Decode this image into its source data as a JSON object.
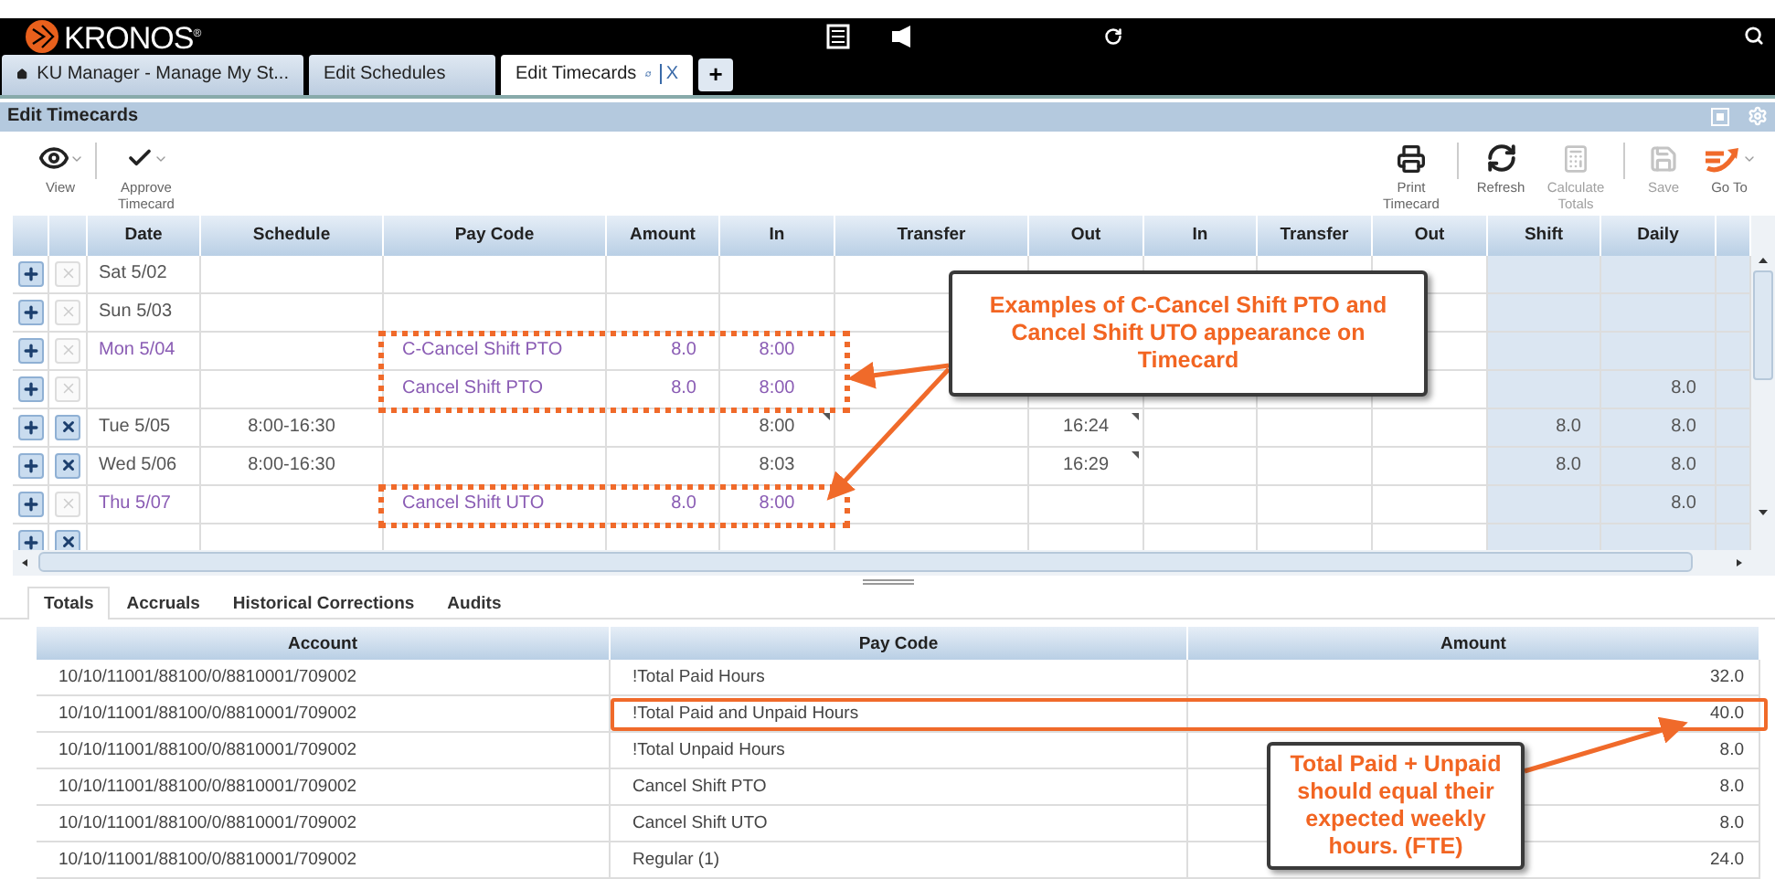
{
  "header": {
    "brand": "KRONOS$^{®}$"
  },
  "tabs": [
    {
      "label": "KU Manager - Manage My St...",
      "selected": false,
      "home": true
    },
    {
      "label": "Edit Schedules",
      "selected": false,
      "home": false
    },
    {
      "label": "Edit Timecards",
      "selected": true,
      "home": false,
      "close": "X"
    }
  ],
  "add_tab": "+",
  "page_title": "Edit Timecards",
  "toolbar_left": [
    {
      "kind": "view",
      "label": "View",
      "disabled": false,
      "dropdown": true
    },
    {
      "kind": "approve",
      "label": "Approve Timecard",
      "disabled": false,
      "dropdown": true
    }
  ],
  "toolbar_right": [
    {
      "kind": "print",
      "label": "Print Timecard",
      "disabled": false,
      "dropdown": false
    },
    {
      "kind": "refresh",
      "label": "Refresh",
      "disabled": false,
      "dropdown": false
    },
    {
      "kind": "calculate",
      "label": "Calculate Totals",
      "disabled": true,
      "dropdown": false
    },
    {
      "kind": "save",
      "label": "Save",
      "disabled": true,
      "dropdown": false
    },
    {
      "kind": "goto",
      "label": "Go To",
      "disabled": false,
      "dropdown": true
    }
  ],
  "timecard": {
    "columns": [
      "Date",
      "Schedule",
      "Pay Code",
      "Amount",
      "In",
      "Transfer",
      "Out",
      "In",
      "Transfer",
      "Out",
      "Shift",
      "Daily"
    ],
    "rows": [
      {
        "date": "Sat 5/02",
        "deletable": false,
        "marked": false,
        "color": "#555555"
      },
      {
        "date": "Sun 5/03",
        "deletable": false,
        "marked": false,
        "color": "#555555"
      },
      {
        "date": "Mon 5/04",
        "pay_code": "C-Cancel Shift PTO",
        "amount": "8.0",
        "in": "8:00",
        "deletable": false,
        "marked": true,
        "color": "#8a5cb4"
      },
      {
        "pay_code": "Cancel Shift PTO",
        "amount": "8.0",
        "in": "8:00",
        "daily": "8.0",
        "deletable": false,
        "marked": true,
        "color": "#8a5cb4"
      },
      {
        "date": "Tue 5/05",
        "schedule": "8:00-16:30",
        "in": "8:00",
        "out": "16:24",
        "shift": "8.0",
        "daily": "8.0",
        "deletable": true,
        "marked": false,
        "in_note": true,
        "out_note": true,
        "color": "#555555"
      },
      {
        "date": "Wed 5/06",
        "schedule": "8:00-16:30",
        "in": "8:03",
        "out": "16:29",
        "shift": "8.0",
        "daily": "8.0",
        "deletable": true,
        "marked": false,
        "out_note": true,
        "color": "#555555"
      },
      {
        "date": "Thu 5/07",
        "pay_code": "Cancel Shift UTO",
        "amount": "8.0",
        "in": "8:00",
        "daily": "8.0",
        "deletable": false,
        "marked": true,
        "color": "#8a5cb4"
      },
      {
        "deletable": true,
        "marked": false
      }
    ]
  },
  "bottom_tabs": [
    {
      "label": "Totals",
      "selected": true
    },
    {
      "label": "Accruals",
      "selected": false
    },
    {
      "label": "Historical Corrections",
      "selected": false
    },
    {
      "label": "Audits",
      "selected": false
    }
  ],
  "totals": {
    "columns": [
      "Account",
      "Pay Code",
      "Amount"
    ],
    "rows": [
      {
        "account": "10/10/11001/88100/0/8810001/709002",
        "pay_code": "!Total Paid Hours",
        "amount": "32.0",
        "highlighted": false
      },
      {
        "account": "10/10/11001/88100/0/8810001/709002",
        "pay_code": "!Total Paid and Unpaid Hours",
        "amount": "40.0",
        "highlighted": true
      },
      {
        "account": "10/10/11001/88100/0/8810001/709002",
        "pay_code": "!Total Unpaid Hours",
        "amount": "8.0",
        "highlighted": false
      },
      {
        "account": "10/10/11001/88100/0/8810001/709002",
        "pay_code": "Cancel Shift PTO",
        "amount": "8.0",
        "highlighted": false
      },
      {
        "account": "10/10/11001/88100/0/8810001/709002",
        "pay_code": "Cancel Shift UTO",
        "amount": "8.0",
        "highlighted": false
      },
      {
        "account": "10/10/11001/88100/0/8810001/709002",
        "pay_code": "Regular (1)",
        "amount": "24.0",
        "highlighted": false
      }
    ]
  },
  "callouts": [
    {
      "text": "Examples of C-Cancel Shift PTO and Cancel Shift UTO appearance on Timecard"
    },
    {
      "text": "Total Paid + Unpaid should equal their expected weekly hours. (FTE)"
    }
  ]
}
